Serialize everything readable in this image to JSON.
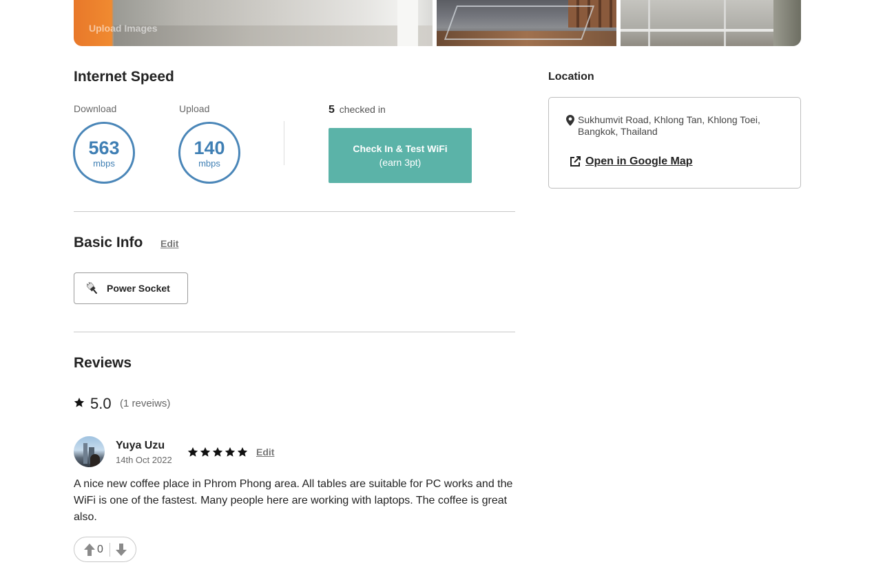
{
  "gallery": {
    "caption": "Upload Images"
  },
  "internet_speed": {
    "title": "Internet Speed",
    "download_label": "Download",
    "download_value": "563",
    "download_unit": "mbps",
    "upload_label": "Upload",
    "upload_value": "140",
    "upload_unit": "mbps",
    "checked_in_count": "5",
    "checked_in_label": "checked in",
    "checkin_button_line1": "Check In & Test WiFi",
    "checkin_button_line2": "(earn 3pt)"
  },
  "basic_info": {
    "title": "Basic Info",
    "edit_label": "Edit",
    "amenities": [
      {
        "label": "Power Socket",
        "icon": "plug-icon"
      }
    ]
  },
  "reviews": {
    "title": "Reviews",
    "average": "5.0",
    "count_text": "(1 reveiws)",
    "items": [
      {
        "name": "Yuya Uzu",
        "date": "14th Oct 2022",
        "stars": 5,
        "edit_label": "Edit",
        "text": "A nice new coffee place in Phrom Phong area. All tables are suitable for PC works and the WiFi is one of the fastest. Many people here are working with laptops. The coffee is great also.",
        "votes": "0"
      }
    ]
  },
  "location": {
    "title": "Location",
    "address": "Sukhumvit Road, Khlong Tan, Khlong Toei, Bangkok, Thailand",
    "map_link": "Open in Google Map"
  },
  "colors": {
    "accent_teal": "#5bb3a8",
    "speed_blue": "#3f7fb4"
  }
}
